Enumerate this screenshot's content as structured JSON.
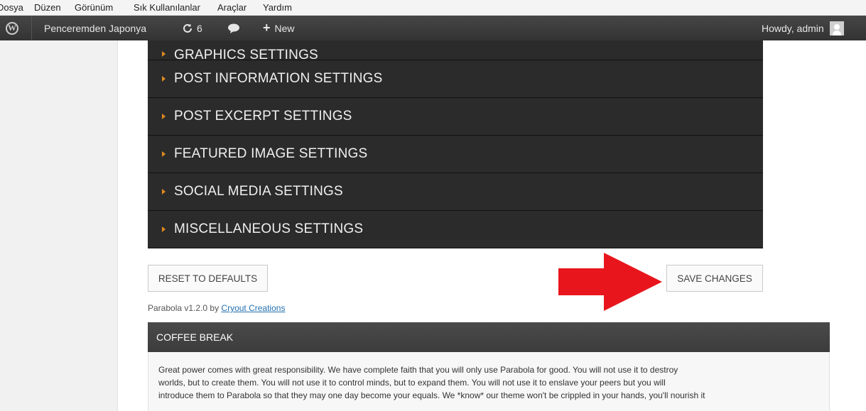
{
  "menubar": {
    "items": [
      "Dosya",
      "Düzen",
      "Görünüm",
      "Sık Kullanılanlar",
      "Araçlar",
      "Yardım"
    ]
  },
  "adminbar": {
    "wp_logo_icon": "wordpress-logo",
    "site_name": "Penceremden Japonya",
    "updates_icon": "refresh-icon",
    "updates_count": "6",
    "comments_icon": "speech-bubble-icon",
    "new_icon": "plus-icon",
    "new_label": "New",
    "howdy": "Howdy, admin",
    "avatar_icon": "user-avatar-icon"
  },
  "settings": {
    "sections": [
      "GRAPHICS SETTINGS",
      "POST INFORMATION SETTINGS",
      "POST EXCERPT SETTINGS",
      "FEATURED IMAGE SETTINGS",
      "SOCIAL MEDIA SETTINGS",
      "MISCELLANEOUS SETTINGS"
    ],
    "accent_color": "#e08a1f"
  },
  "actions": {
    "reset_label": "RESET TO DEFAULTS",
    "save_label": "SAVE CHANGES",
    "arrow_color": "#e8161c"
  },
  "credit": {
    "prefix": "Parabola v1.2.0 by ",
    "link": "Cryout Creations"
  },
  "coffee": {
    "title": "COFFEE BREAK",
    "lines": [
      "Great power comes with great responsibility. We have complete faith that you will only use Parabola for good. You will not use it to destroy",
      "worlds, but to create them. You will not use it to control minds, but to expand them. You will not use it to enslave your peers but you will",
      "introduce them to Parabola so that they may one day become your equals. We *know* our theme won't be crippled in your hands, you'll nourish it"
    ]
  }
}
